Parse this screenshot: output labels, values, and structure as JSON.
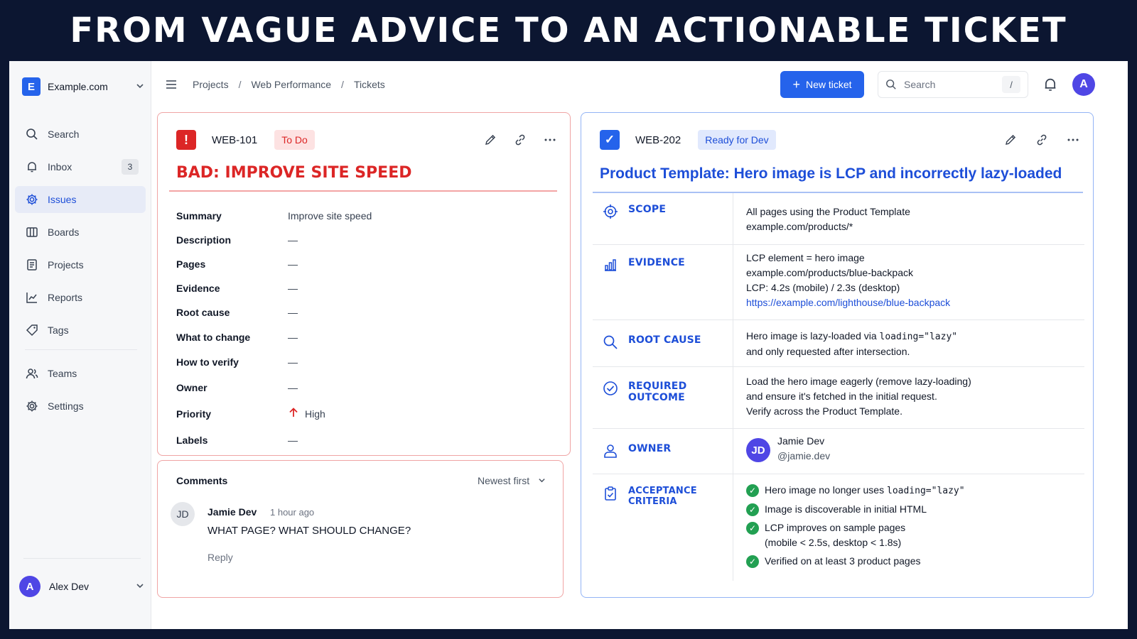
{
  "banner": {
    "title": "FROM VAGUE ADVICE TO AN ACTIONABLE TICKET"
  },
  "sidebar": {
    "workspace_initial": "E",
    "workspace_name": "Example.com",
    "items": [
      {
        "label": "Search",
        "icon": "search-icon"
      },
      {
        "label": "Inbox",
        "icon": "inbox-icon",
        "count": "3"
      },
      {
        "label": "Issues",
        "icon": "gear-icon",
        "active": true
      },
      {
        "label": "Boards",
        "icon": "boards-icon"
      },
      {
        "label": "Projects",
        "icon": "document-icon"
      },
      {
        "label": "Reports",
        "icon": "chart-icon"
      },
      {
        "label": "Tags",
        "icon": "tag-icon"
      },
      {
        "label": "Teams",
        "icon": "people-icon"
      },
      {
        "label": "Settings",
        "icon": "gear-icon"
      }
    ],
    "user": {
      "initial": "A",
      "name": "Alex Dev"
    }
  },
  "topbar": {
    "breadcrumbs": [
      "Projects",
      "Web Performance",
      "Tickets"
    ],
    "separator": "/",
    "new_ticket": "New ticket",
    "search_placeholder": "Search",
    "search_shortcut": "/",
    "avatar_initial": "A"
  },
  "bad_ticket": {
    "icon_glyph": "!",
    "id": "WEB-101",
    "status": "To Do",
    "title": "BAD: IMPROVE SITE SPEED",
    "fields": [
      {
        "key": "Summary",
        "value": "Improve site speed"
      },
      {
        "key": "Description",
        "value": "—"
      },
      {
        "key": "Pages",
        "value": "—"
      },
      {
        "key": "Evidence",
        "value": "—"
      },
      {
        "key": "Root cause",
        "value": "—"
      },
      {
        "key": "What to change",
        "value": "—"
      },
      {
        "key": "How to verify",
        "value": "—"
      },
      {
        "key": "Owner",
        "value": "—"
      },
      {
        "key": "Priority",
        "value": "High"
      },
      {
        "key": "Labels",
        "value": "—"
      }
    ],
    "comments": {
      "title": "Comments",
      "sort": "Newest first",
      "author_initials": "JD",
      "author": "Jamie Dev",
      "time": "1 hour ago",
      "text": "WHAT PAGE? WHAT SHOULD CHANGE?",
      "reply": "Reply"
    }
  },
  "good_ticket": {
    "icon_glyph": "✓",
    "id": "WEB-202",
    "status": "Ready for Dev",
    "title": "Product Template: Hero image is LCP and incorrectly lazy-loaded",
    "scope": {
      "label": "SCOPE",
      "line1": "All pages using the Product Template",
      "line2": "example.com/products/*"
    },
    "evidence": {
      "label": "EVIDENCE",
      "line1": "LCP element = hero image",
      "line2": "example.com/products/blue-backpack",
      "line3": "LCP: 4.2s (mobile) / 2.3s (desktop)",
      "link": "https://example.com/lighthouse/blue-backpack"
    },
    "root_cause": {
      "label": "ROOT CAUSE",
      "pre": "Hero image is lazy-loaded via ",
      "code": "loading=\"lazy\"",
      "line2": "and only requested after intersection."
    },
    "outcome": {
      "label": "REQUIRED OUTCOME",
      "line1": "Load the hero image eagerly (remove lazy-loading)",
      "line2": "and ensure it's fetched in the initial request.",
      "line3": "Verify across the Product Template."
    },
    "owner": {
      "label": "OWNER",
      "initials": "JD",
      "name": "Jamie Dev",
      "handle": "@jamie.dev"
    },
    "acceptance": {
      "label": "ACCEPTANCE CRITERIA",
      "c1_pre": "Hero image no longer uses ",
      "c1_code": "loading=\"lazy\"",
      "c2": "Image is discoverable in initial HTML",
      "c3_line1": "LCP improves on sample pages",
      "c3_line2": "(mobile < 2.5s, desktop < 1.8s)",
      "c4": "Verified on at least 3 product pages"
    }
  },
  "colors": {
    "accent": "#2563eb",
    "bad": "#dc2626",
    "good_check": "#22a052",
    "banner_bg": "#0c1631"
  }
}
